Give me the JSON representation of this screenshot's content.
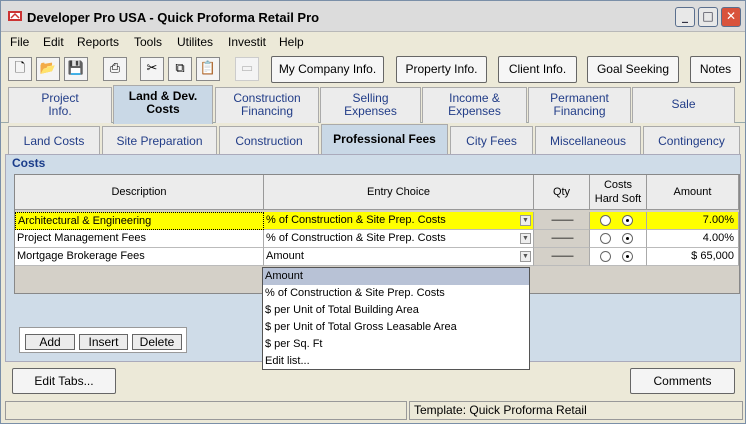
{
  "window": {
    "title": "Developer Pro  USA - Quick Proforma Retail Pro",
    "minimize": "_",
    "maximize": "□",
    "close": "✕"
  },
  "menu": [
    "File",
    "Edit",
    "Reports",
    "Tools",
    "Utilites",
    "Investit",
    "Help"
  ],
  "toolbar": {
    "icons": [
      "new-document-icon",
      "open-folder-icon",
      "save-disk-icon",
      "print-icon",
      "cut-icon",
      "copy-icon",
      "paste-icon",
      "disabled-icon"
    ],
    "buttons": [
      "My Company Info.",
      "Property Info.",
      "Client Info.",
      "Goal Seeking",
      "Notes"
    ]
  },
  "tabs_main": [
    {
      "label": "Project\nInfo."
    },
    {
      "label": "Land & Dev.\nCosts"
    },
    {
      "label": "Construction\nFinancing"
    },
    {
      "label": "Selling\nExpenses"
    },
    {
      "label": "Income &\nExpenses"
    },
    {
      "label": "Permanent\nFinancing"
    },
    {
      "label": "Sale"
    }
  ],
  "tabs_sub": [
    "Land Costs",
    "Site Preparation",
    "Construction",
    "Professional Fees",
    "City Fees",
    "Miscellaneous",
    "Contingency"
  ],
  "section_title": "Costs",
  "table": {
    "headers": {
      "description": "Description",
      "entry_choice": "Entry Choice",
      "qty": "Qty",
      "costs": "Costs",
      "hard": "Hard",
      "soft": "Soft",
      "amount": "Amount"
    },
    "rows": [
      {
        "description": "Architectural & Engineering",
        "entry": "% of Construction & Site Prep. Costs",
        "qty": "——",
        "amount": "7.00%",
        "selected": "soft"
      },
      {
        "description": "Project Management Fees",
        "entry": "% of Construction & Site Prep. Costs",
        "qty": "——",
        "amount": "4.00%",
        "selected": "soft"
      },
      {
        "description": "Mortgage Brokerage Fees",
        "entry": "Amount",
        "qty": "——",
        "amount": "$ 65,000",
        "selected": "soft"
      }
    ]
  },
  "dropdown": {
    "options": [
      "Amount",
      "% of Construction & Site Prep. Costs",
      "$ per Unit of Total Building Area",
      "$ per Unit of Total Gross Leasable Area",
      "$ per Sq. Ft",
      "Edit list..."
    ],
    "selected": "Amount"
  },
  "row_buttons": {
    "add": "Add",
    "insert": "Insert",
    "delete": "Delete"
  },
  "bottom_buttons": {
    "edit_tabs": "Edit Tabs...",
    "comments": "Comments"
  },
  "status": {
    "left": "",
    "template": "Template: Quick Proforma Retail"
  }
}
